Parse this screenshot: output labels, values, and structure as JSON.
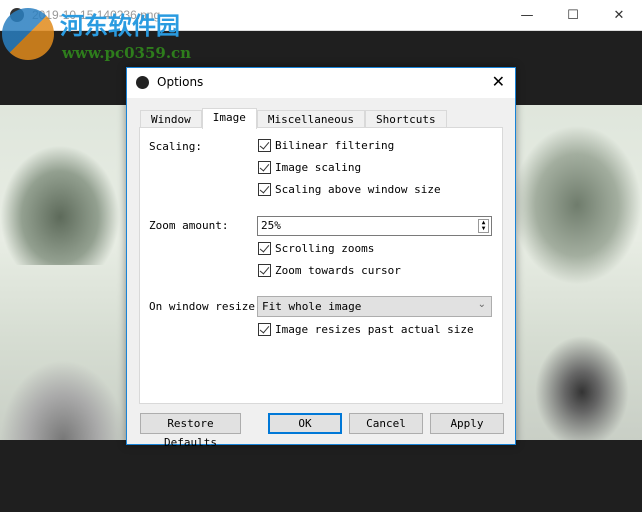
{
  "window": {
    "title": "2019-10-15 140236.png",
    "minimize": "—",
    "maximize": "☐",
    "close": "✕"
  },
  "watermark": {
    "name": "河东软件园",
    "url": "www.pc0359.cn"
  },
  "dialog": {
    "title": "Options",
    "close": "✕",
    "tabs": [
      {
        "label": "Window"
      },
      {
        "label": "Image"
      },
      {
        "label": "Miscellaneous"
      },
      {
        "label": "Shortcuts"
      }
    ],
    "active_tab": "Image",
    "scaling_label": "Scaling:",
    "bilinear": "Bilinear filtering",
    "image_scaling": "Image scaling",
    "scaling_above": "Scaling above window size",
    "zoom_label": "Zoom amount:",
    "zoom_value": "25%",
    "scrolling_zooms": "Scrolling zooms",
    "zoom_towards": "Zoom towards cursor",
    "resize_label": "On window resize:",
    "resize_value": "Fit whole image",
    "resize_past": "Image resizes past actual size",
    "buttons": {
      "restore": "Restore Defaults",
      "ok": "OK",
      "cancel": "Cancel",
      "apply": "Apply"
    }
  }
}
